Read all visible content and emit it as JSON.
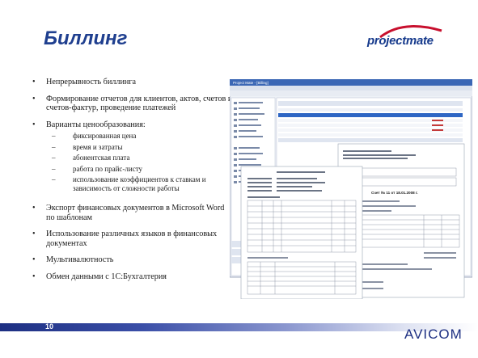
{
  "title": "Биллинг",
  "logo": {
    "text": "projectmate"
  },
  "bullets": [
    {
      "text": "Непрерывность биллинга"
    },
    {
      "text": "Формирование отчетов для клиентов, актов, счетов и счетов-фактур, проведение платежей"
    },
    {
      "text": "Варианты ценообразования:"
    }
  ],
  "pricing_options": [
    "фиксированная цена",
    "время и затраты",
    "абонентская плата",
    "работа по прайс-листу",
    "использование коэффициентов к ставкам и зависимость от сложности работы"
  ],
  "bullets2": [
    {
      "text": "Экспорт финансовых документов в Microsoft Word по шаблонам"
    },
    {
      "text": "Использование различных языков в финансовых документах"
    },
    {
      "text": "Мультивалютность"
    },
    {
      "text": "Обмен данными с 1С:Бухгалтерия"
    }
  ],
  "bullet_symbol": "•",
  "dash_symbol": "–",
  "page_number": "10",
  "footer_brand": "AVICOM",
  "colors": {
    "title": "#1f3f8f",
    "logo": "#163a8c",
    "logo_swoosh": "#c8102e",
    "footer": "#1d2f82"
  },
  "screenshot": {
    "app_title": "Project Mate - [Billing]",
    "invoice_title": "Счет № 11 от 18.01.2008 г."
  }
}
